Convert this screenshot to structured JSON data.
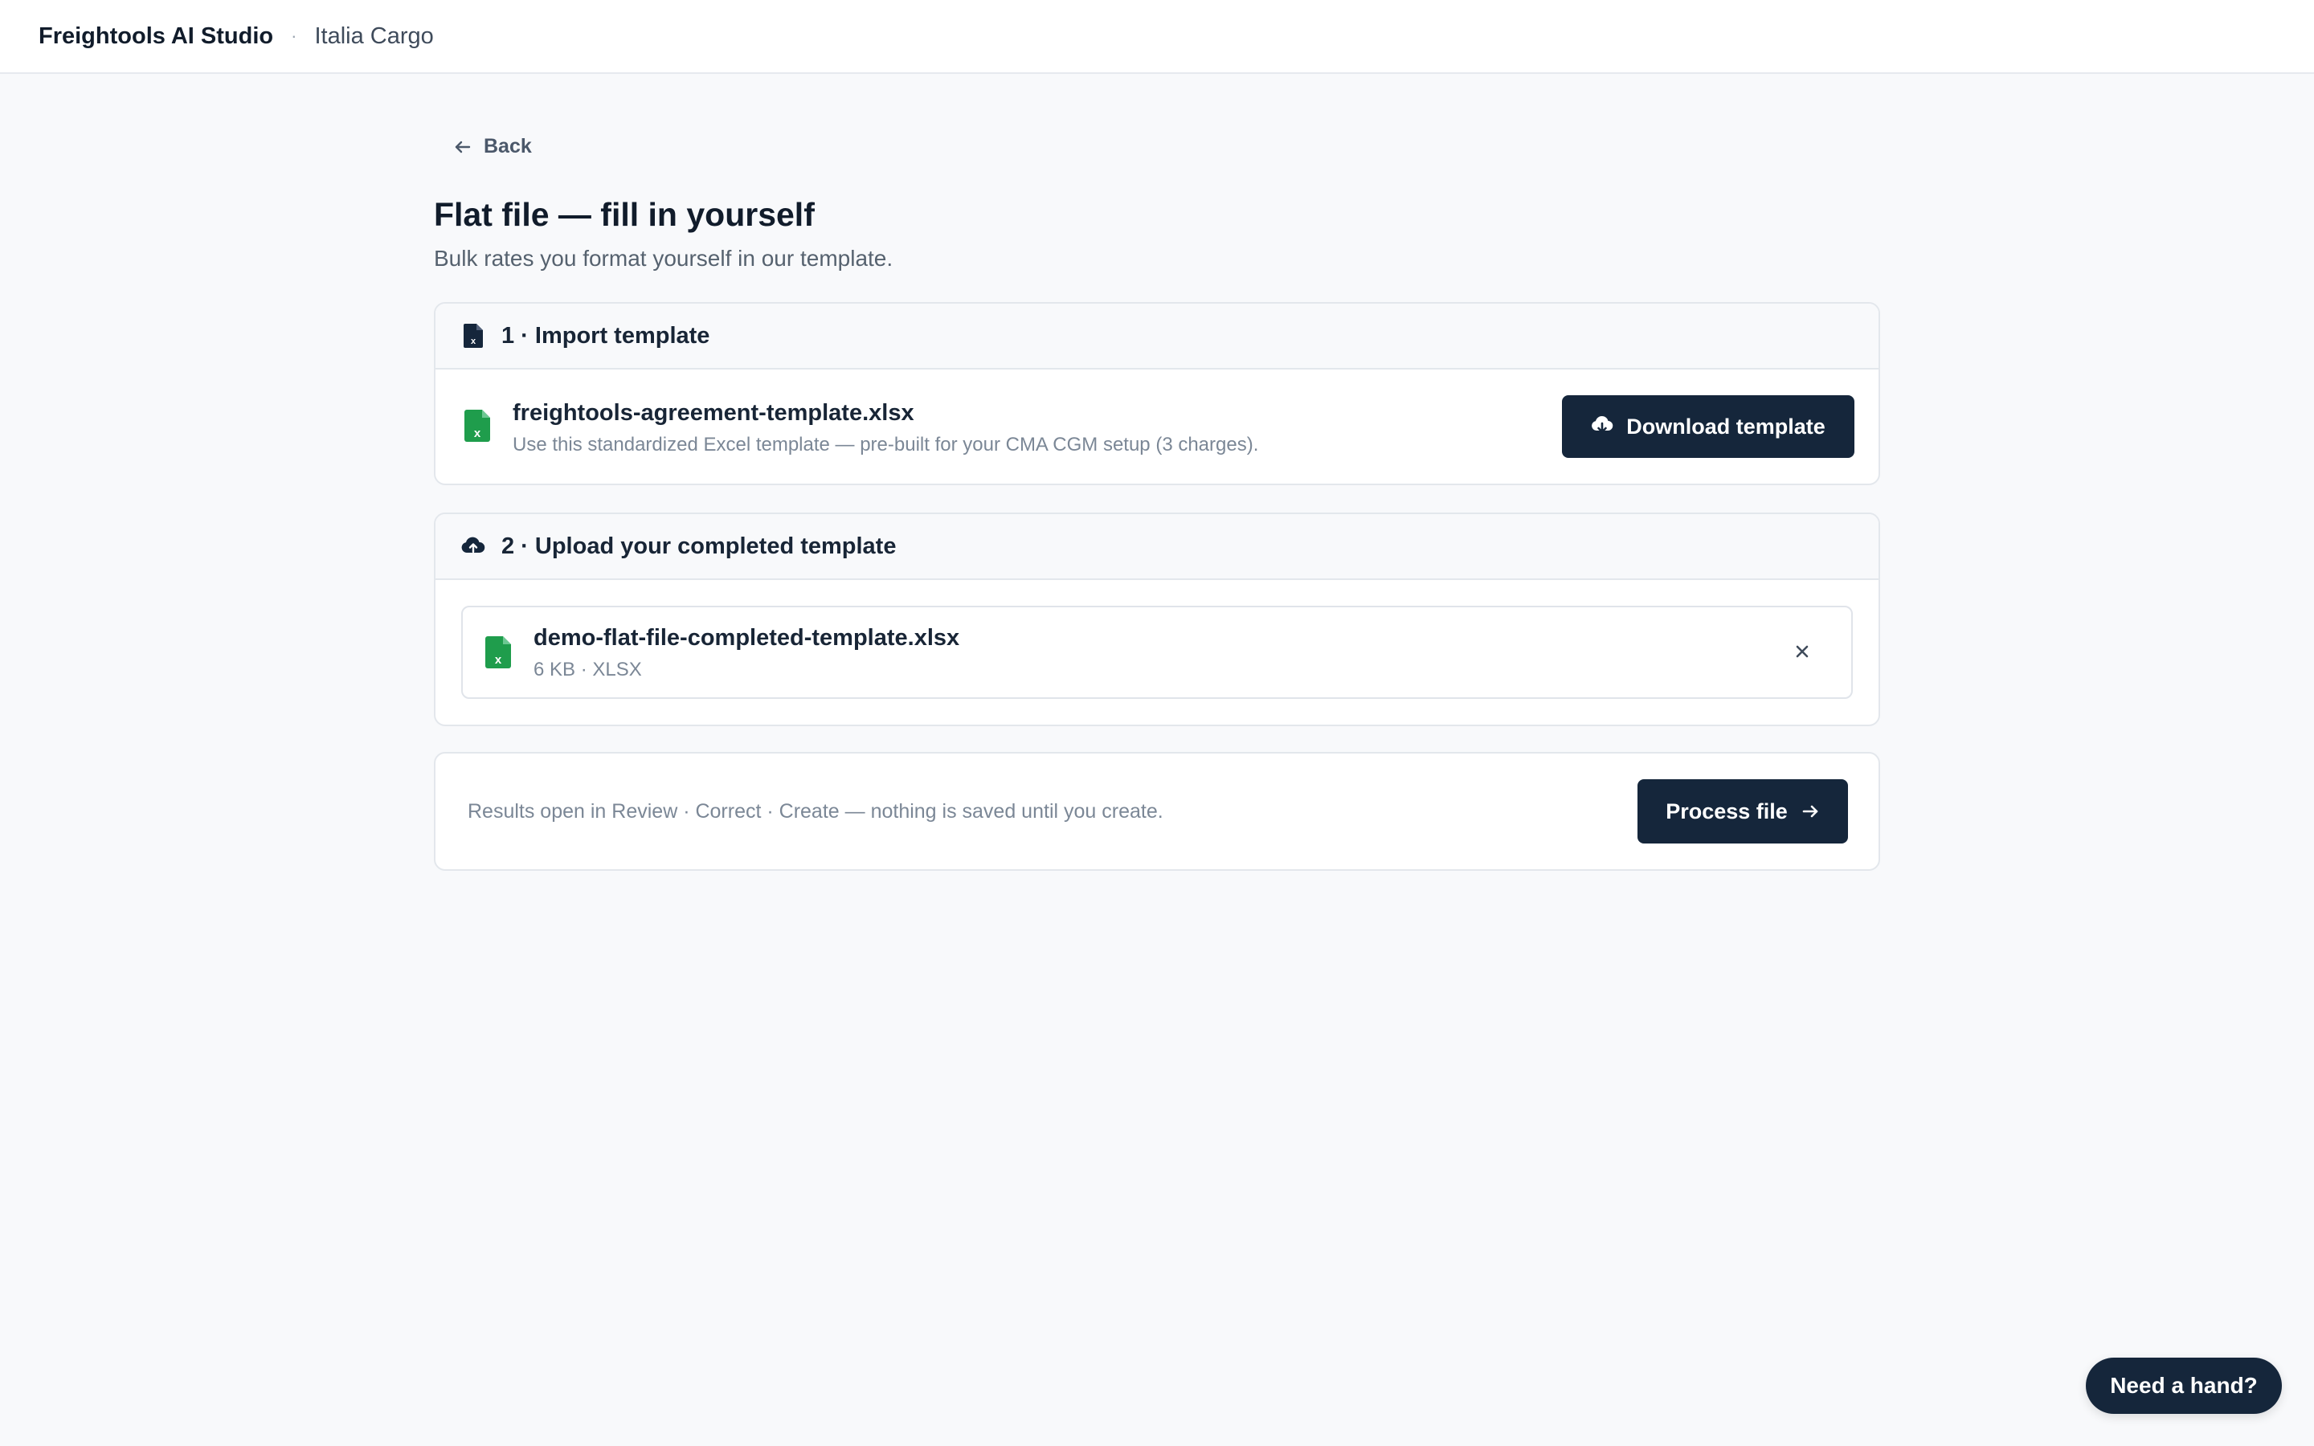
{
  "header": {
    "app_name": "Freightools AI Studio",
    "separator": "·",
    "org_name": "Italia Cargo"
  },
  "nav": {
    "back_label": "Back"
  },
  "page": {
    "title": "Flat file — fill in yourself",
    "subtitle": "Bulk rates you format yourself in our template."
  },
  "step1": {
    "heading": "1 · Import template",
    "file_name": "freightools-agreement-template.xlsx",
    "file_desc": "Use this standardized Excel template — pre-built for your CMA CGM setup (3 charges).",
    "download_label": "Download template"
  },
  "step2": {
    "heading": "2 · Upload your completed template",
    "file_name": "demo-flat-file-completed-template.xlsx",
    "file_meta": "6 KB · XLSX"
  },
  "footer": {
    "note": "Results open in Review · Correct · Create — nothing is saved until you create.",
    "process_label": "Process file"
  },
  "help": {
    "label": "Need a hand?"
  },
  "colors": {
    "accent_dark": "#15263b",
    "excel_green": "#1f9d4c",
    "background": "#f8f9fb"
  },
  "icons": [
    "arrow-left-icon",
    "file-excel-icon",
    "cloud-upload-icon",
    "download-icon",
    "close-icon",
    "arrow-right-icon"
  ]
}
